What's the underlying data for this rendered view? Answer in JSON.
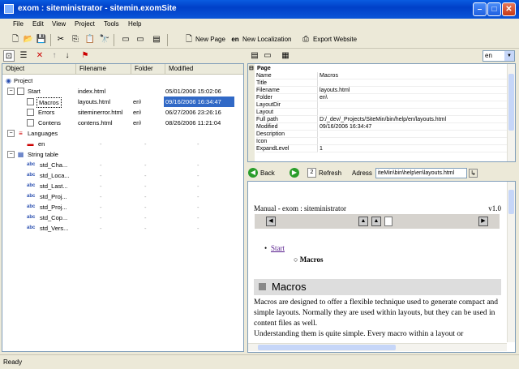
{
  "window": {
    "title": "exom : siteministrator - sitemin.exomSite"
  },
  "menu": [
    "File",
    "Edit",
    "View",
    "Project",
    "Tools",
    "Help"
  ],
  "toolbar": {
    "new_page": "New Page",
    "new_localization": "New Localization",
    "export_website": "Export Website"
  },
  "tree": {
    "columns": [
      "Object",
      "Filename",
      "Folder",
      "Modified"
    ],
    "rows": [
      {
        "name": "Project",
        "filename": "",
        "folder": "",
        "modified": ""
      },
      {
        "name": "Start",
        "filename": "index.html",
        "folder": "",
        "modified": "05/01/2006 15:02:06"
      },
      {
        "name": "Macros",
        "filename": "layouts.html",
        "folder": "en\\",
        "modified": "09/16/2006 16:34:47"
      },
      {
        "name": "Errors",
        "filename": "siteminerror.html",
        "folder": "en\\",
        "modified": "06/27/2006 23:26:16"
      },
      {
        "name": "Contens",
        "filename": "contens.html",
        "folder": "en\\",
        "modified": "08/26/2006 11:21:04"
      },
      {
        "name": "Languages",
        "filename": "",
        "folder": "",
        "modified": ""
      },
      {
        "name": "en",
        "filename": "-",
        "folder": "-",
        "modified": "-"
      },
      {
        "name": "String table",
        "filename": "",
        "folder": "",
        "modified": ""
      },
      {
        "name": "std_Cha...",
        "filename": "-",
        "folder": "-",
        "modified": "-"
      },
      {
        "name": "std_Loca...",
        "filename": "-",
        "folder": "-",
        "modified": "-"
      },
      {
        "name": "std_Last...",
        "filename": "-",
        "folder": "-",
        "modified": "-"
      },
      {
        "name": "std_Proj...",
        "filename": "-",
        "folder": "-",
        "modified": "-"
      },
      {
        "name": "std_Proj...",
        "filename": "-",
        "folder": "-",
        "modified": "-"
      },
      {
        "name": "std_Cop...",
        "filename": "-",
        "folder": "-",
        "modified": "-"
      },
      {
        "name": "std_Vers...",
        "filename": "-",
        "folder": "-",
        "modified": "-"
      }
    ]
  },
  "language_select": "en",
  "properties": {
    "group": "Page",
    "rows": [
      {
        "key": "Name",
        "value": "Macros"
      },
      {
        "key": "Title",
        "value": ""
      },
      {
        "key": "Filename",
        "value": "layouts.html"
      },
      {
        "key": "Folder",
        "value": "en\\"
      },
      {
        "key": "LayoutDir",
        "value": ""
      },
      {
        "key": "Layout",
        "value": ""
      },
      {
        "key": "Full path",
        "value": "D:/_dev/_Projects/SiteMin/bin/help/en/layouts.html"
      },
      {
        "key": "Modified",
        "value": "09/16/2006 16:34:47"
      },
      {
        "key": "Description",
        "value": ""
      },
      {
        "key": "Icon",
        "value": ""
      },
      {
        "key": "ExpandLevel",
        "value": "1"
      }
    ]
  },
  "nav": {
    "back": "Back",
    "refresh": "Refresh",
    "address_label": "Adress",
    "address": "iteMin\\bin\\help\\en\\layouts.html"
  },
  "browser": {
    "header_left": "Manual - exom : siteministrator",
    "header_right": "v1.0",
    "link_start": "Start",
    "sub_item": "Macros",
    "heading": "Macros",
    "para1": "Macros are designed to offer a flexible technique used to generate compact and simple layouts. Normally they are used within layouts, but they can be used in content files as well.",
    "para2": "Understanding them is quite simple. Every macro within a layout or"
  },
  "status": "Ready"
}
